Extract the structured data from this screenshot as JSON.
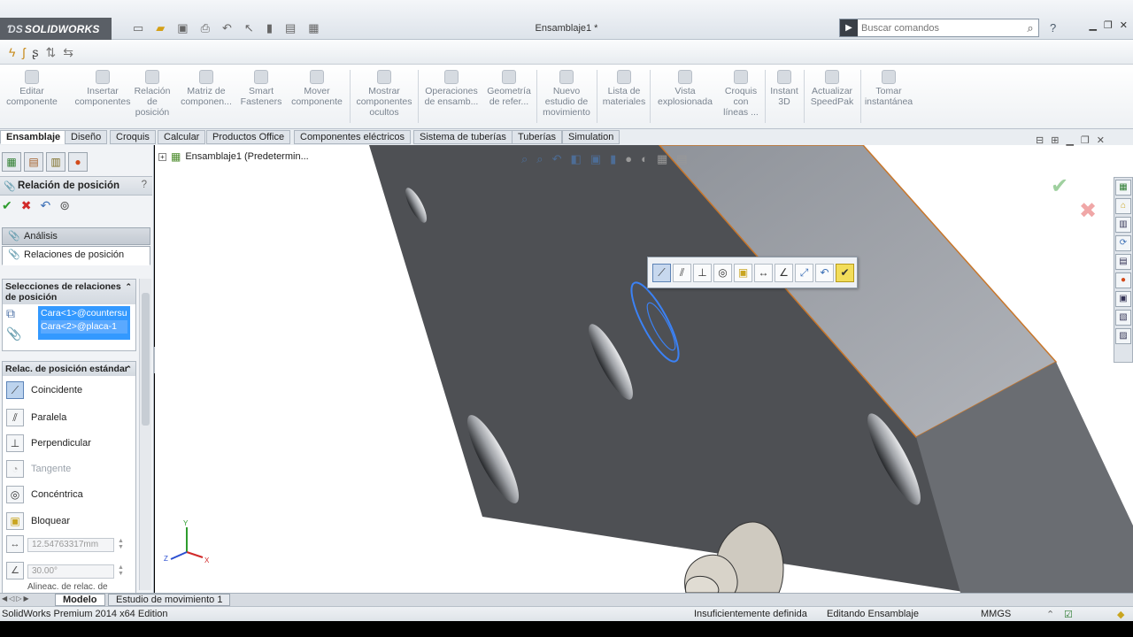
{
  "app": {
    "brand": "SOLIDWORKS",
    "document_title": "Ensamblaje1 *",
    "search_placeholder": "Buscar comandos"
  },
  "command_manager": [
    {
      "name": "Editar\ncomponente"
    },
    {
      "name": "Insertar\ncomponentes"
    },
    {
      "name": "Relación\nde\nposición"
    },
    {
      "name": "Matriz de\ncomponen..."
    },
    {
      "name": "Smart\nFasteners"
    },
    {
      "name": "Mover\ncomponente"
    },
    {
      "name": "Mostrar\ncomponentes\nocultos"
    },
    {
      "name": "Operaciones\nde ensamb..."
    },
    {
      "name": "Geometría\nde refer..."
    },
    {
      "name": "Nuevo\nestudio de\nmovimiento"
    },
    {
      "name": "Lista de\nmateriales"
    },
    {
      "name": "Vista\nexplosionada"
    },
    {
      "name": "Croquis\ncon\nlíneas ..."
    },
    {
      "name": "Instant\n3D"
    },
    {
      "name": "Actualizar\nSpeedPak"
    },
    {
      "name": "Tomar\ninstantánea"
    }
  ],
  "tabs": [
    "Ensamblaje",
    "Diseño",
    "Croquis",
    "Calcular",
    "Productos Office",
    "Componentes eléctricos",
    "Sistema de tuberías",
    "Tuberías",
    "Simulation"
  ],
  "property_manager": {
    "title": "Relación de posición",
    "help": "?",
    "tab_analysis": "Análisis",
    "tab_mates": "Relaciones de posición",
    "selections_title": "Selecciones de relaciones de posición",
    "selections": [
      "Cara<1>@countersu",
      "Cara<2>@placa-1"
    ],
    "standard_title": "Relac. de posición estándar",
    "mates": [
      {
        "label": "Coincidente",
        "icon": "coincident-icon",
        "glyph": "⟋",
        "selected": true,
        "enabled": true
      },
      {
        "label": "Paralela",
        "icon": "parallel-icon",
        "glyph": "⫽",
        "selected": false,
        "enabled": true
      },
      {
        "label": "Perpendicular",
        "icon": "perpendicular-icon",
        "glyph": "⊥",
        "selected": false,
        "enabled": true
      },
      {
        "label": "Tangente",
        "icon": "tangent-icon",
        "glyph": "◔",
        "selected": false,
        "enabled": false
      },
      {
        "label": "Concéntrica",
        "icon": "concentric-icon",
        "glyph": "◎",
        "selected": false,
        "enabled": true
      },
      {
        "label": "Bloquear",
        "icon": "lock-icon",
        "glyph": "🔒",
        "selected": false,
        "enabled": true
      }
    ],
    "distance_value": "12.54763317mm",
    "angle_value": "30.00°",
    "alignment_label": "Alineac. de relac. de"
  },
  "tree": {
    "root_label": "Ensamblaje1  (Predetermin..."
  },
  "triad": {
    "x": "X",
    "y": "Y",
    "z": "Z"
  },
  "bottom_tabs": [
    "Modelo",
    "Estudio de movimiento 1"
  ],
  "status": {
    "edition": "SolidWorks Premium 2014 x64 Edition",
    "definition": "Insuficientemente definida",
    "mode": "Editando Ensamblaje",
    "units": "MMGS"
  },
  "colors": {
    "selection_blue": "#3399ff",
    "part_dark": "#4d4f53",
    "part_light": "#a3a6ad",
    "edge_orange": "#c8762a",
    "highlight": "#3b82f6"
  }
}
